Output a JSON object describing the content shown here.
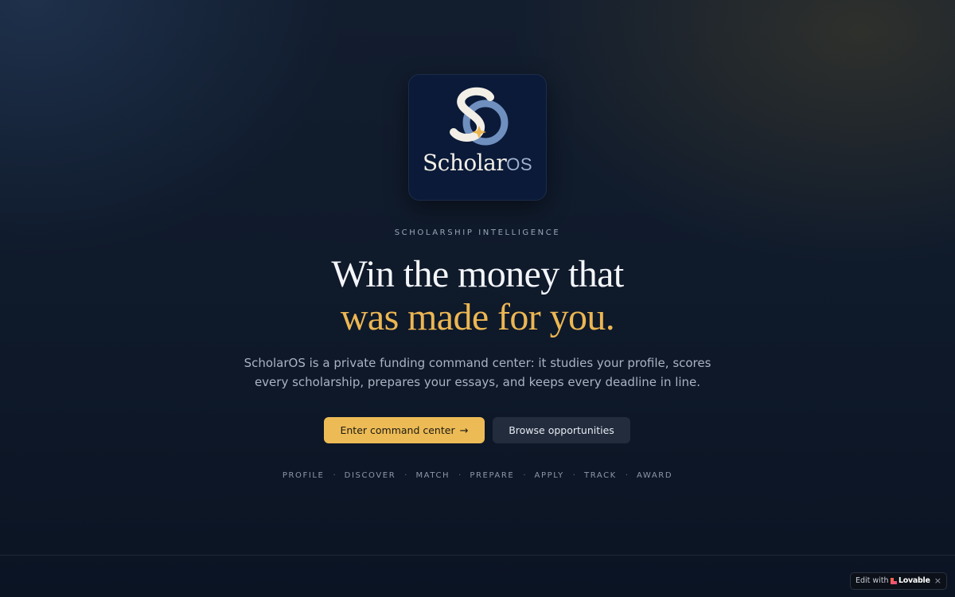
{
  "logo": {
    "wordmark_primary": "Scholar",
    "wordmark_secondary": "OS",
    "colors": {
      "card": "#0a1a38",
      "mark_light": "#f3efe6",
      "mark_accent": "#6f8fbf",
      "star": "#ecb652"
    }
  },
  "hero": {
    "eyebrow": "SCHOLARSHIP INTELLIGENCE",
    "headline_line1": "Win the money that",
    "headline_line2": "was made for you.",
    "description": "ScholarOS is a private funding command center: it studies your profile, scores every scholarship, prepares your essays, and keeps every deadline in line."
  },
  "actions": {
    "primary_label": "Enter command center",
    "primary_icon": "arrow-right-icon",
    "secondary_label": "Browse opportunities"
  },
  "steps": [
    "PROFILE",
    "DISCOVER",
    "MATCH",
    "PREPARE",
    "APPLY",
    "TRACK",
    "AWARD"
  ],
  "step_separator": "·",
  "badge": {
    "edit_label": "Edit with",
    "brand": "Lovable",
    "close_glyph": "×"
  },
  "colors": {
    "accent": "#edbb55",
    "headline_accent": "#ecb652",
    "background": "#0f1a2b"
  }
}
